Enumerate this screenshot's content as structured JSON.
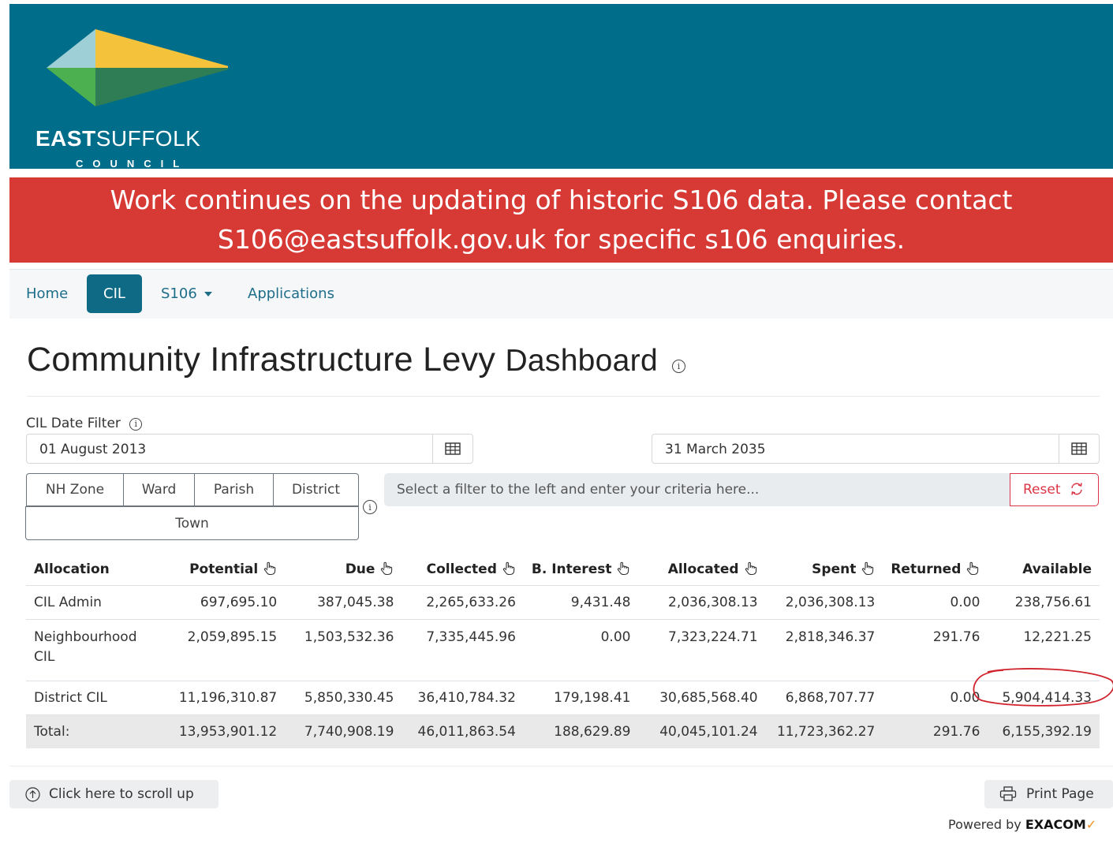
{
  "header": {
    "logo_name_bold": "EAST",
    "logo_name_light": "SUFFOLK",
    "logo_sub": "COUNCIL",
    "colors": {
      "header_bg": "#006d8a",
      "logo_yellow": "#f5c33b",
      "logo_green": "#4caf50",
      "logo_blue": "#9ecfd6"
    }
  },
  "banner": {
    "text": "Work continues on the updating of historic S106 data. Please contact S106@eastsuffolk.gov.uk for specific s106 enquiries.",
    "color": "#d73a35"
  },
  "nav": {
    "items": [
      {
        "label": "Home",
        "active": false
      },
      {
        "label": "CIL",
        "active": true
      },
      {
        "label": "S106",
        "active": false,
        "dropdown": true
      },
      {
        "label": "Applications",
        "active": false
      }
    ]
  },
  "page": {
    "title_main": "Community Infrastructure Levy",
    "title_sub": "Dashboard"
  },
  "filter": {
    "label": "CIL Date Filter",
    "start_date": "01 August 2013",
    "end_date": "31 March 2035",
    "segments": [
      "NH Zone",
      "Ward",
      "Parish",
      "District"
    ],
    "town": "Town",
    "criteria_placeholder": "Select a filter to the left and enter your criteria here...",
    "reset_label": "Reset"
  },
  "table": {
    "headers": [
      "Allocation",
      "Potential",
      "Due",
      "Collected",
      "B. Interest",
      "Allocated",
      "Spent",
      "Returned",
      "Available"
    ],
    "rows": [
      {
        "allocation": "CIL Admin",
        "potential": "697,695.10",
        "due": "387,045.38",
        "collected": "2,265,633.26",
        "interest": "9,431.48",
        "allocated": "2,036,308.13",
        "spent": "2,036,308.13",
        "returned": "0.00",
        "available": "238,756.61"
      },
      {
        "allocation_line1": "Neighbourhood",
        "allocation_line2": "CIL",
        "potential": "2,059,895.15",
        "due": "1,503,532.36",
        "collected": "7,335,445.96",
        "interest": "0.00",
        "allocated": "7,323,224.71",
        "spent": "2,818,346.37",
        "returned": "291.76",
        "available": "12,221.25"
      },
      {
        "allocation": "District CIL",
        "potential": "11,196,310.87",
        "due": "5,850,330.45",
        "collected": "36,410,784.32",
        "interest": "179,198.41",
        "allocated": "30,685,568.40",
        "spent": "6,868,707.77",
        "returned": "0.00",
        "available": "5,904,414.33"
      }
    ],
    "total": {
      "label": "Total:",
      "potential": "13,953,901.12",
      "due": "7,740,908.19",
      "collected": "46,011,863.54",
      "interest": "188,629.89",
      "allocated": "40,045,101.24",
      "spent": "11,723,362.27",
      "returned": "291.76",
      "available": "6,155,392.19"
    }
  },
  "annotation": {
    "color": "#d0222a"
  },
  "footer": {
    "scroll_label": "Click here to scroll up",
    "print_label": "Print Page",
    "powered_prefix": "Powered by",
    "powered_brand": "EXACOM"
  }
}
